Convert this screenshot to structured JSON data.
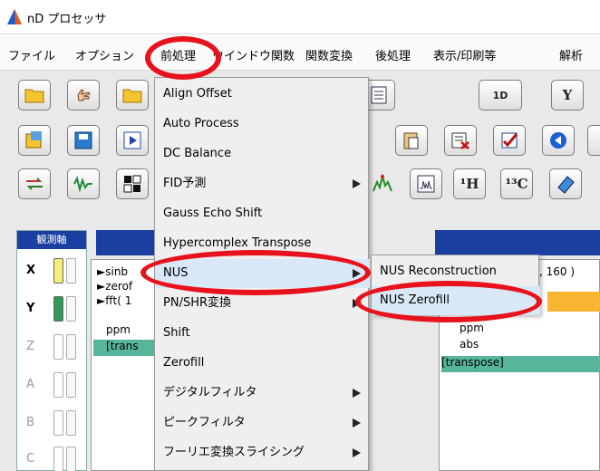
{
  "window": {
    "title": "nD プロセッサ"
  },
  "menubar": [
    "ファイル",
    "オプション",
    "前処理",
    "ウインドウ関数",
    "関数変換",
    "後処理",
    "表示/印刷等",
    "解析"
  ],
  "toolbar": {
    "button_1d": "1D",
    "button_y": "Y",
    "button_1h": "¹H",
    "button_13c": "¹³C"
  },
  "axis_panel": {
    "header": "観測軸",
    "axes": [
      "X",
      "Y",
      "Z",
      "A",
      "B",
      "C"
    ]
  },
  "left_list": {
    "lines": [
      "►sinb",
      "►zerof",
      "►fft( 1",
      "ppm",
      "[trans"
    ]
  },
  "right_list": {
    "lines": [
      ", 160 )",
      "ppm",
      "abs",
      "[transpose]"
    ]
  },
  "preprocess_menu": {
    "items": [
      {
        "label": "Align Offset",
        "submenu": false
      },
      {
        "label": "Auto Process",
        "submenu": false
      },
      {
        "label": "DC Balance",
        "submenu": false
      },
      {
        "label": "FID予測",
        "submenu": true
      },
      {
        "label": "Gauss Echo Shift",
        "submenu": false
      },
      {
        "label": "Hypercomplex Transpose",
        "submenu": false
      },
      {
        "label": "NUS",
        "submenu": true,
        "highlighted": true
      },
      {
        "label": "PN/SHR変換",
        "submenu": true
      },
      {
        "label": "Shift",
        "submenu": false
      },
      {
        "label": "Zerofill",
        "submenu": false
      },
      {
        "label": "デジタルフィルタ",
        "submenu": true
      },
      {
        "label": "ピークフィルタ",
        "submenu": true
      },
      {
        "label": "フーリエ変換スライシング",
        "submenu": true
      }
    ]
  },
  "nus_submenu": {
    "items": [
      {
        "label": "NUS Reconstruction"
      },
      {
        "label": "NUS Zerofill",
        "highlighted": true
      }
    ]
  },
  "colors": {
    "highlight_ring": "#e8121c",
    "panel_header": "#1a3fa0",
    "selected_row": "#56b59a",
    "menu_hover": "#d8e8f6"
  }
}
